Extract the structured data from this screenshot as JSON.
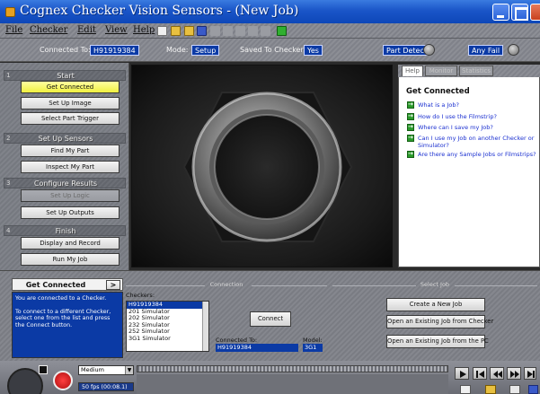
{
  "window": {
    "title": "Cognex Checker Vision Sensors - (New Job)"
  },
  "menu": {
    "items": [
      "File",
      "Checker",
      "Edit",
      "View",
      "Help"
    ]
  },
  "status": {
    "connected_label": "Connected To:",
    "connected_value": "H91919384",
    "mode_label": "Mode:",
    "mode_value": "Setup",
    "saved_label": "Saved To Checker:",
    "saved_value": "Yes",
    "part_detect": "Part Detect",
    "any_fail": "Any Fail"
  },
  "steps": {
    "sections": [
      {
        "num": "1",
        "title": "Start",
        "buttons": [
          "Get Connected",
          "Set Up Image",
          "Select Part Trigger"
        ]
      },
      {
        "num": "2",
        "title": "Set Up Sensors",
        "buttons": [
          "Find My Part",
          "Inspect My Part"
        ]
      },
      {
        "num": "3",
        "title": "Configure Results",
        "buttons": [
          "Set Up Logic",
          "Set Up Outputs"
        ]
      },
      {
        "num": "4",
        "title": "Finish",
        "buttons": [
          "Display and Record",
          "Run My Job"
        ]
      }
    ]
  },
  "help": {
    "tabs": [
      "Help",
      "Monitor",
      "Statistics"
    ],
    "heading": "Get Connected",
    "links": [
      "What is a Job?",
      "How do I use the Filmstrip?",
      "Where can I save my Job?",
      "Can I use my Job on another Checker or Simulator?",
      "Are there any Sample Jobs or Filmstrips?"
    ]
  },
  "bottom": {
    "get_connected_title": "Get Connected",
    "next_arrow": ">",
    "desc_1": "You are connected to a Checker.",
    "desc_2": "To connect to a different Checker, select one from the list and press the Connect button.",
    "connection_group": "Connection",
    "checkers_label": "Checkers:",
    "checkers": [
      "H91919384",
      "201 Simulator",
      "202 Simulator",
      "232 Simulator",
      "252 Simulator",
      "3G1 Simulator"
    ],
    "connect_button": "Connect",
    "connected_to_label": "Connected To:",
    "connected_to_value": "H91919384",
    "model_label": "Model:",
    "model_value": "3G1",
    "select_job_group": "Select Job",
    "create_job": "Create a New Job",
    "open_from_checker": "Open an Existing Job from Checker",
    "open_from_pc": "Open an Existing Job from the PC"
  },
  "timeline": {
    "speed": "Medium",
    "fps": "50 fps (00:08.1)"
  }
}
